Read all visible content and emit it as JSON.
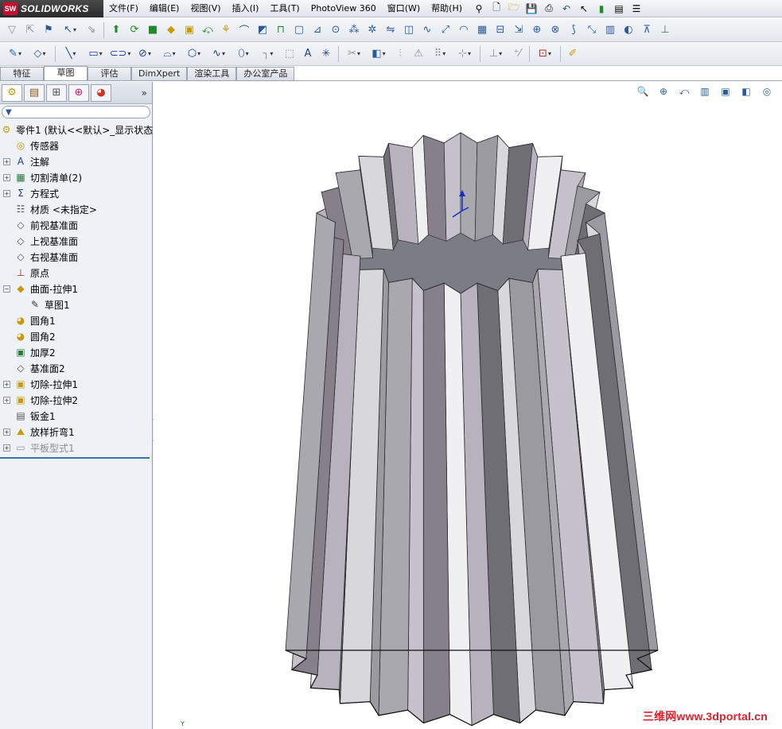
{
  "app": {
    "logo_badge": "SW",
    "logo_text": "SOLIDWORKS"
  },
  "menu": [
    "文件(F)",
    "编辑(E)",
    "视图(V)",
    "插入(I)",
    "工具(T)",
    "PhotoView 360",
    "窗口(W)",
    "帮助(H)"
  ],
  "command_tabs": [
    "特征",
    "草图",
    "评估",
    "DimXpert",
    "渲染工具",
    "办公室产品"
  ],
  "active_tab": "草图",
  "feature_tree": {
    "root": "零件1  (默认<<默认>_显示状态",
    "items": [
      {
        "label": "传感器",
        "icon": "sensor-icon",
        "expandable": false
      },
      {
        "label": "注解",
        "icon": "annotation-icon",
        "expandable": true
      },
      {
        "label": "切割清单(2)",
        "icon": "cut-list-icon",
        "expandable": true
      },
      {
        "label": "方程式",
        "icon": "equation-icon",
        "expandable": true
      },
      {
        "label": "材质 <未指定>",
        "icon": "material-icon",
        "expandable": false
      },
      {
        "label": "前视基准面",
        "icon": "plane-icon",
        "expandable": false
      },
      {
        "label": "上视基准面",
        "icon": "plane-icon",
        "expandable": false
      },
      {
        "label": "右视基准面",
        "icon": "plane-icon",
        "expandable": false
      },
      {
        "label": "原点",
        "icon": "origin-icon",
        "expandable": false
      },
      {
        "label": "曲面-拉伸1",
        "icon": "surface-extrude-icon",
        "expandable": true,
        "expanded": true
      },
      {
        "label": "草图1",
        "icon": "sketch-icon",
        "expandable": false,
        "child": true
      },
      {
        "label": "圆角1",
        "icon": "fillet-icon",
        "expandable": false
      },
      {
        "label": "圆角2",
        "icon": "fillet-icon",
        "expandable": false
      },
      {
        "label": "加厚2",
        "icon": "thicken-icon",
        "expandable": false
      },
      {
        "label": "基准面2",
        "icon": "plane-icon",
        "expandable": false
      },
      {
        "label": "切除-拉伸1",
        "icon": "cut-extrude-icon",
        "expandable": true
      },
      {
        "label": "切除-拉伸2",
        "icon": "cut-extrude-icon",
        "expandable": true
      },
      {
        "label": "钣金1",
        "icon": "sheet-metal-icon",
        "expandable": false
      },
      {
        "label": "放样折弯1",
        "icon": "lofted-bend-icon",
        "expandable": true
      },
      {
        "label": "平板型式1",
        "icon": "flat-pattern-icon",
        "expandable": true,
        "dim": true
      }
    ]
  },
  "viewport": {
    "triad_label": "Y",
    "watermark": "三维网www.3dportal.cn"
  }
}
